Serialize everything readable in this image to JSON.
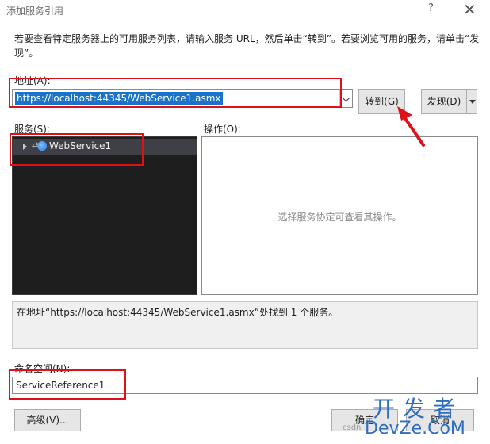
{
  "window": {
    "title": "添加服务引用",
    "help_glyph": "?",
    "close_glyph": "✕"
  },
  "instruction": "若要查看特定服务器上的可用服务列表，请输入服务 URL，然后单击“转到”。若要浏览可用的服务，请单击“发现”。",
  "address": {
    "label": "地址(A):",
    "value": "https://localhost:44345/WebService1.asmx"
  },
  "buttons": {
    "goto": "转到(G)",
    "discover": "发现(D)",
    "advanced": "高级(V)...",
    "ok": "确定",
    "cancel": "取消"
  },
  "services": {
    "label": "服务(S):",
    "items": [
      {
        "label": "WebService1",
        "icon": "web-service-icon"
      }
    ]
  },
  "operations": {
    "label": "操作(O):",
    "placeholder": "选择服务协定可查看其操作。"
  },
  "status": "在地址“https://localhost:44345/WebService1.asmx”处找到 1 个服务。",
  "namespace": {
    "label": "命名空间(N):",
    "value": "ServiceReference1"
  },
  "watermark": {
    "line1": "开发者",
    "line2": "DevZe.CoM",
    "small": "csdn"
  },
  "colors": {
    "annotation": "#e0101a",
    "selection": "#1a73c8",
    "tree_background": "#1e1e1e"
  }
}
